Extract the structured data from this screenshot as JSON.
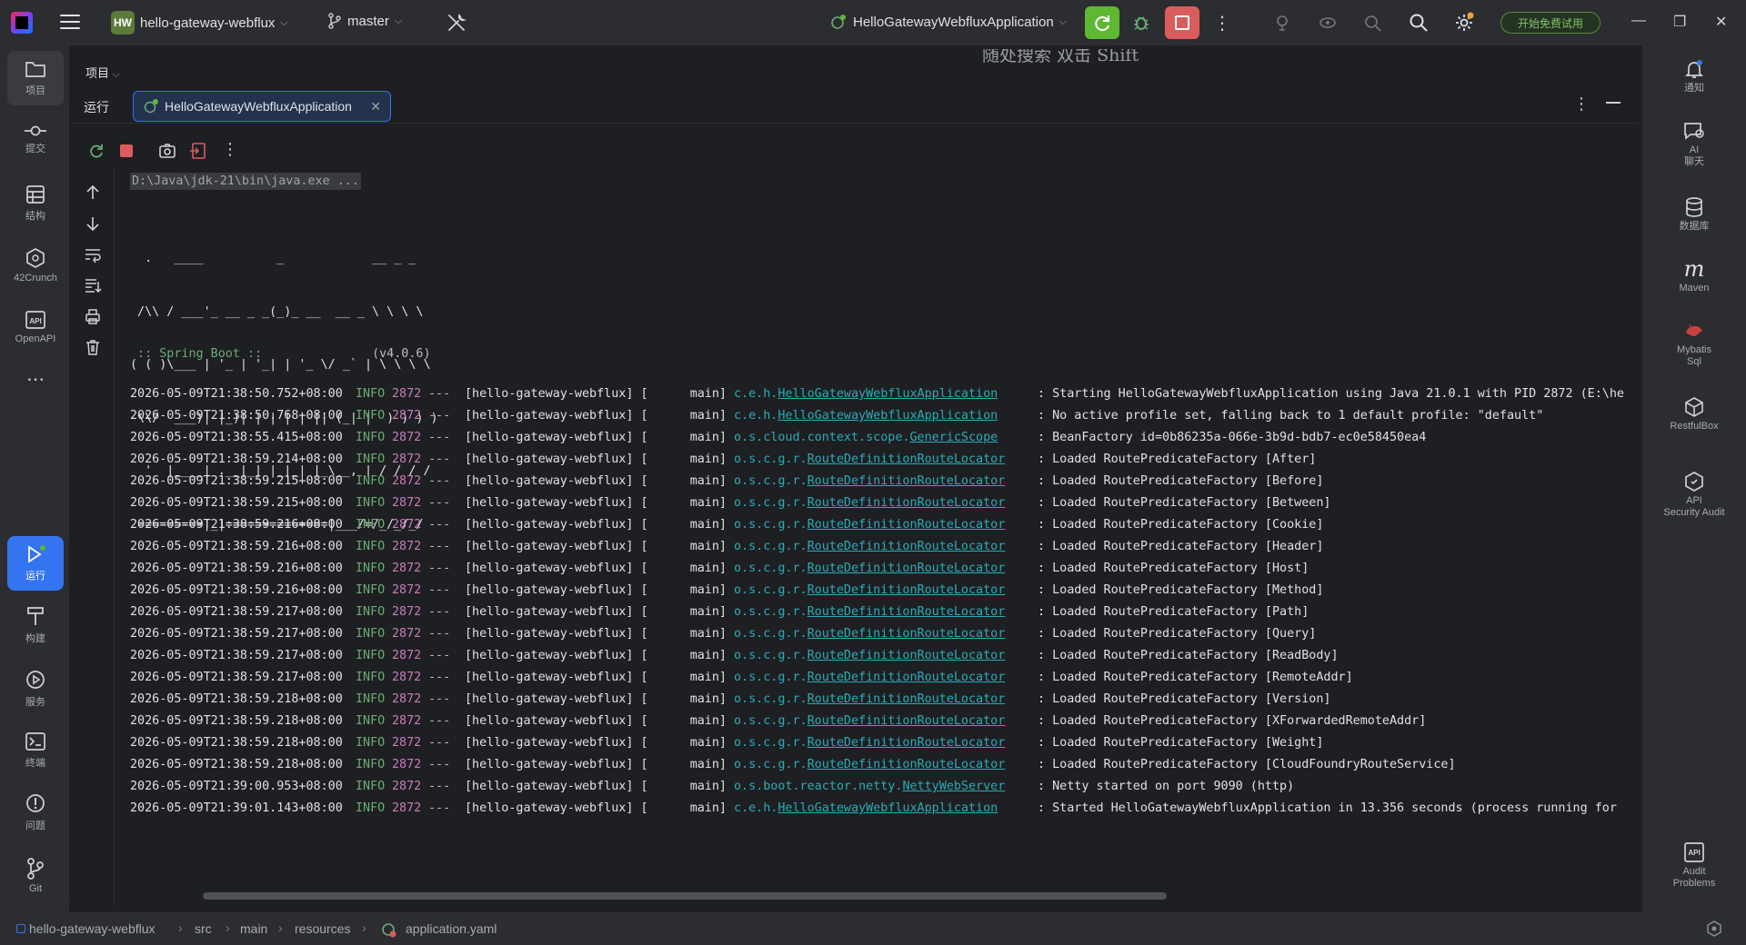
{
  "titlebar": {
    "project_badge": "HW",
    "project_name": "hello-gateway-webflux",
    "branch": "master",
    "run_config": "HelloGatewayWebfluxApplication",
    "trial_button": "开始免费试用"
  },
  "left_toolbar": [
    {
      "label": "项目",
      "icon": "folder-icon"
    },
    {
      "label": "提交",
      "icon": "commit-icon"
    },
    {
      "label": "结构",
      "icon": "structure-icon"
    },
    {
      "label": "42Crunch",
      "icon": "42crunch-icon"
    },
    {
      "label": "OpenAPI",
      "icon": "openapi-icon"
    },
    {
      "label": "运行",
      "icon": "run-icon"
    },
    {
      "label": "构建",
      "icon": "build-icon"
    },
    {
      "label": "服务",
      "icon": "services-icon"
    },
    {
      "label": "终端",
      "icon": "terminal-icon"
    },
    {
      "label": "问题",
      "icon": "problems-icon"
    },
    {
      "label": "Git",
      "icon": "git-icon"
    }
  ],
  "right_toolbar": [
    {
      "label": "通知",
      "icon": "bell-icon"
    },
    {
      "label": "AI\n聊天",
      "icon": "ai-chat-icon"
    },
    {
      "label": "数据库",
      "icon": "database-icon"
    },
    {
      "label": "Maven",
      "icon": "maven-icon"
    },
    {
      "label": "Mybatis\nSql",
      "icon": "mybatis-icon"
    },
    {
      "label": "RestfulBox",
      "icon": "restfulbox-icon"
    },
    {
      "label": "API\nSecurity Audit",
      "icon": "api-security-icon"
    },
    {
      "label": "Audit\nProblems",
      "icon": "audit-problems-icon"
    }
  ],
  "project_strip": {
    "title": "项目"
  },
  "search_strip": {
    "hint": "随处搜索  双击 Shift"
  },
  "run_panel": {
    "title": "运行",
    "tab_label": "HelloGatewayWebfluxApplication"
  },
  "console": {
    "command": "D:\\Java\\jdk-21\\bin\\java.exe ...",
    "banner": [
      "  .   ____          _            __ _ _",
      " /\\\\ / ___'_ __ _ _(_)_ __  __ _ \\ \\ \\ \\",
      "( ( )\\___ | '_ | '_| | '_ \\/ _` | \\ \\ \\ \\",
      " \\\\/  ___)| |_)| | | | | || (_| |  ) ) ) )",
      "  '  |____| .__|_| |_|_| |_\\__, | / / / /",
      " =========|_|==============|___/=/_/_/_/"
    ],
    "spring_label": " :: Spring Boot ::",
    "spring_version": "(v4.0.6)",
    "logs": [
      {
        "ts": "2026-05-09T21:38:50.752+08:00",
        "level": "INFO",
        "pid": "2872",
        "dash": "---",
        "app": "[hello-gateway-webflux] [",
        "thread": "main]",
        "logger_prefix": "c.e.h.",
        "logger_class": "HelloGatewayWebfluxApplication",
        "msg": ": Starting HelloGatewayWebfluxApplication using Java 21.0.1 with PID 2872 (E:\\he"
      },
      {
        "ts": "2026-05-09T21:38:50.768+08:00",
        "level": "INFO",
        "pid": "2872",
        "dash": "---",
        "app": "[hello-gateway-webflux] [",
        "thread": "main]",
        "logger_prefix": "c.e.h.",
        "logger_class": "HelloGatewayWebfluxApplication",
        "msg": ": No active profile set, falling back to 1 default profile: \"default\""
      },
      {
        "ts": "2026-05-09T21:38:55.415+08:00",
        "level": "INFO",
        "pid": "2872",
        "dash": "---",
        "app": "[hello-gateway-webflux] [",
        "thread": "main]",
        "logger_prefix": "o.s.cloud.context.scope.",
        "logger_class": "GenericScope",
        "msg": ": BeanFactory id=0b86235a-066e-3b9d-bdb7-ec0e58450ea4"
      },
      {
        "ts": "2026-05-09T21:38:59.214+08:00",
        "level": "INFO",
        "pid": "2872",
        "dash": "---",
        "app": "[hello-gateway-webflux] [",
        "thread": "main]",
        "logger_prefix": "o.s.c.g.r.",
        "logger_class": "RouteDefinitionRouteLocator",
        "msg": ": Loaded RoutePredicateFactory [After]"
      },
      {
        "ts": "2026-05-09T21:38:59.215+08:00",
        "level": "INFO",
        "pid": "2872",
        "dash": "---",
        "app": "[hello-gateway-webflux] [",
        "thread": "main]",
        "logger_prefix": "o.s.c.g.r.",
        "logger_class": "RouteDefinitionRouteLocator",
        "msg": ": Loaded RoutePredicateFactory [Before]"
      },
      {
        "ts": "2026-05-09T21:38:59.215+08:00",
        "level": "INFO",
        "pid": "2872",
        "dash": "---",
        "app": "[hello-gateway-webflux] [",
        "thread": "main]",
        "logger_prefix": "o.s.c.g.r.",
        "logger_class": "RouteDefinitionRouteLocator",
        "msg": ": Loaded RoutePredicateFactory [Between]"
      },
      {
        "ts": "2026-05-09T21:38:59.216+08:00",
        "level": "INFO",
        "pid": "2872",
        "dash": "---",
        "app": "[hello-gateway-webflux] [",
        "thread": "main]",
        "logger_prefix": "o.s.c.g.r.",
        "logger_class": "RouteDefinitionRouteLocator",
        "msg": ": Loaded RoutePredicateFactory [Cookie]"
      },
      {
        "ts": "2026-05-09T21:38:59.216+08:00",
        "level": "INFO",
        "pid": "2872",
        "dash": "---",
        "app": "[hello-gateway-webflux] [",
        "thread": "main]",
        "logger_prefix": "o.s.c.g.r.",
        "logger_class": "RouteDefinitionRouteLocator",
        "msg": ": Loaded RoutePredicateFactory [Header]"
      },
      {
        "ts": "2026-05-09T21:38:59.216+08:00",
        "level": "INFO",
        "pid": "2872",
        "dash": "---",
        "app": "[hello-gateway-webflux] [",
        "thread": "main]",
        "logger_prefix": "o.s.c.g.r.",
        "logger_class": "RouteDefinitionRouteLocator",
        "msg": ": Loaded RoutePredicateFactory [Host]"
      },
      {
        "ts": "2026-05-09T21:38:59.216+08:00",
        "level": "INFO",
        "pid": "2872",
        "dash": "---",
        "app": "[hello-gateway-webflux] [",
        "thread": "main]",
        "logger_prefix": "o.s.c.g.r.",
        "logger_class": "RouteDefinitionRouteLocator",
        "msg": ": Loaded RoutePredicateFactory [Method]"
      },
      {
        "ts": "2026-05-09T21:38:59.217+08:00",
        "level": "INFO",
        "pid": "2872",
        "dash": "---",
        "app": "[hello-gateway-webflux] [",
        "thread": "main]",
        "logger_prefix": "o.s.c.g.r.",
        "logger_class": "RouteDefinitionRouteLocator",
        "msg": ": Loaded RoutePredicateFactory [Path]"
      },
      {
        "ts": "2026-05-09T21:38:59.217+08:00",
        "level": "INFO",
        "pid": "2872",
        "dash": "---",
        "app": "[hello-gateway-webflux] [",
        "thread": "main]",
        "logger_prefix": "o.s.c.g.r.",
        "logger_class": "RouteDefinitionRouteLocator",
        "msg": ": Loaded RoutePredicateFactory [Query]"
      },
      {
        "ts": "2026-05-09T21:38:59.217+08:00",
        "level": "INFO",
        "pid": "2872",
        "dash": "---",
        "app": "[hello-gateway-webflux] [",
        "thread": "main]",
        "logger_prefix": "o.s.c.g.r.",
        "logger_class": "RouteDefinitionRouteLocator",
        "msg": ": Loaded RoutePredicateFactory [ReadBody]"
      },
      {
        "ts": "2026-05-09T21:38:59.217+08:00",
        "level": "INFO",
        "pid": "2872",
        "dash": "---",
        "app": "[hello-gateway-webflux] [",
        "thread": "main]",
        "logger_prefix": "o.s.c.g.r.",
        "logger_class": "RouteDefinitionRouteLocator",
        "msg": ": Loaded RoutePredicateFactory [RemoteAddr]"
      },
      {
        "ts": "2026-05-09T21:38:59.218+08:00",
        "level": "INFO",
        "pid": "2872",
        "dash": "---",
        "app": "[hello-gateway-webflux] [",
        "thread": "main]",
        "logger_prefix": "o.s.c.g.r.",
        "logger_class": "RouteDefinitionRouteLocator",
        "msg": ": Loaded RoutePredicateFactory [Version]"
      },
      {
        "ts": "2026-05-09T21:38:59.218+08:00",
        "level": "INFO",
        "pid": "2872",
        "dash": "---",
        "app": "[hello-gateway-webflux] [",
        "thread": "main]",
        "logger_prefix": "o.s.c.g.r.",
        "logger_class": "RouteDefinitionRouteLocator",
        "msg": ": Loaded RoutePredicateFactory [XForwardedRemoteAddr]"
      },
      {
        "ts": "2026-05-09T21:38:59.218+08:00",
        "level": "INFO",
        "pid": "2872",
        "dash": "---",
        "app": "[hello-gateway-webflux] [",
        "thread": "main]",
        "logger_prefix": "o.s.c.g.r.",
        "logger_class": "RouteDefinitionRouteLocator",
        "msg": ": Loaded RoutePredicateFactory [Weight]"
      },
      {
        "ts": "2026-05-09T21:38:59.218+08:00",
        "level": "INFO",
        "pid": "2872",
        "dash": "---",
        "app": "[hello-gateway-webflux] [",
        "thread": "main]",
        "logger_prefix": "o.s.c.g.r.",
        "logger_class": "RouteDefinitionRouteLocator",
        "msg": ": Loaded RoutePredicateFactory [CloudFoundryRouteService]"
      },
      {
        "ts": "2026-05-09T21:39:00.953+08:00",
        "level": "INFO",
        "pid": "2872",
        "dash": "---",
        "app": "[hello-gateway-webflux] [",
        "thread": "main]",
        "logger_prefix": "o.s.boot.reactor.netty.",
        "logger_class": "NettyWebServer",
        "msg": ": Netty started on port 9090 (http)"
      },
      {
        "ts": "2026-05-09T21:39:01.143+08:00",
        "level": "INFO",
        "pid": "2872",
        "dash": "---",
        "app": "[hello-gateway-webflux] [",
        "thread": "main]",
        "logger_prefix": "c.e.h.",
        "logger_class": "HelloGatewayWebfluxApplication",
        "msg": ": Started HelloGatewayWebfluxApplication in 13.356 seconds (process running for"
      }
    ]
  },
  "statusbar": {
    "crumbs": [
      "hello-gateway-webflux",
      "src",
      "main",
      "resources",
      "application.yaml"
    ]
  },
  "colors": {
    "accent": "#3574f0",
    "run_green": "#5fb832",
    "stop_red": "#db5c5c",
    "log_level": "#6aab73",
    "pid": "#c77dbb",
    "logger": "#2aacb8"
  }
}
